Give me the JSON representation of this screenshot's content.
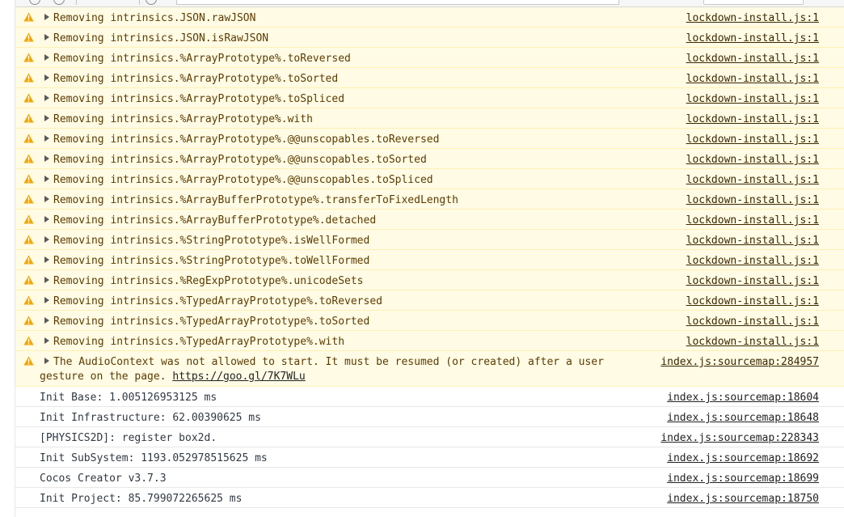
{
  "console": {
    "messages": [
      {
        "level": "warning",
        "text": "Removing intrinsics.JSON.rawJSON",
        "source": "lockdown-install.js:1"
      },
      {
        "level": "warning",
        "text": "Removing intrinsics.JSON.isRawJSON",
        "source": "lockdown-install.js:1"
      },
      {
        "level": "warning",
        "text": "Removing intrinsics.%ArrayPrototype%.toReversed",
        "source": "lockdown-install.js:1"
      },
      {
        "level": "warning",
        "text": "Removing intrinsics.%ArrayPrototype%.toSorted",
        "source": "lockdown-install.js:1"
      },
      {
        "level": "warning",
        "text": "Removing intrinsics.%ArrayPrototype%.toSpliced",
        "source": "lockdown-install.js:1"
      },
      {
        "level": "warning",
        "text": "Removing intrinsics.%ArrayPrototype%.with",
        "source": "lockdown-install.js:1"
      },
      {
        "level": "warning",
        "text": "Removing intrinsics.%ArrayPrototype%.@@unscopables.toReversed",
        "source": "lockdown-install.js:1"
      },
      {
        "level": "warning",
        "text": "Removing intrinsics.%ArrayPrototype%.@@unscopables.toSorted",
        "source": "lockdown-install.js:1"
      },
      {
        "level": "warning",
        "text": "Removing intrinsics.%ArrayPrototype%.@@unscopables.toSpliced",
        "source": "lockdown-install.js:1"
      },
      {
        "level": "warning",
        "text": "Removing intrinsics.%ArrayBufferPrototype%.transferToFixedLength",
        "source": "lockdown-install.js:1"
      },
      {
        "level": "warning",
        "text": "Removing intrinsics.%ArrayBufferPrototype%.detached",
        "source": "lockdown-install.js:1"
      },
      {
        "level": "warning",
        "text": "Removing intrinsics.%StringPrototype%.isWellFormed",
        "source": "lockdown-install.js:1"
      },
      {
        "level": "warning",
        "text": "Removing intrinsics.%StringPrototype%.toWellFormed",
        "source": "lockdown-install.js:1"
      },
      {
        "level": "warning",
        "text": "Removing intrinsics.%RegExpPrototype%.unicodeSets",
        "source": "lockdown-install.js:1"
      },
      {
        "level": "warning",
        "text": "Removing intrinsics.%TypedArrayPrototype%.toReversed",
        "source": "lockdown-install.js:1"
      },
      {
        "level": "warning",
        "text": "Removing intrinsics.%TypedArrayPrototype%.toSorted",
        "source": "lockdown-install.js:1"
      },
      {
        "level": "warning",
        "text": "Removing intrinsics.%TypedArrayPrototype%.with",
        "source": "lockdown-install.js:1"
      }
    ],
    "audio_warning": {
      "level": "warning",
      "line1": "The AudioContext was not allowed to start. It must be resumed (or created) after a user",
      "line2_prefix": "gesture on the page. ",
      "link": "https://goo.gl/7K7WLu",
      "source": "index.js:sourcemap:284957"
    },
    "info_messages": [
      {
        "level": "info",
        "text": "Init Base: 1.005126953125 ms",
        "source": "index.js:sourcemap:18604"
      },
      {
        "level": "info",
        "text": "Init Infrastructure: 62.00390625 ms",
        "source": "index.js:sourcemap:18648"
      },
      {
        "level": "info",
        "text": "[PHYSICS2D]: register box2d.",
        "source": "index.js:sourcemap:228343"
      },
      {
        "level": "info",
        "text": "Init SubSystem: 1193.052978515625 ms",
        "source": "index.js:sourcemap:18692"
      },
      {
        "level": "info",
        "text": "Cocos Creator v3.7.3",
        "source": "index.js:sourcemap:18699"
      },
      {
        "level": "info",
        "text": "Init Project: 85.799072265625 ms",
        "source": "index.js:sourcemap:18750"
      }
    ]
  },
  "icons": {
    "warning": "warning-triangle-icon",
    "expand": "caret-right-icon"
  },
  "colors": {
    "warning_bg": "#fffbe5",
    "warning_border": "#fff0b3",
    "warning_icon": "#f2a600",
    "info_text": "#303942"
  }
}
